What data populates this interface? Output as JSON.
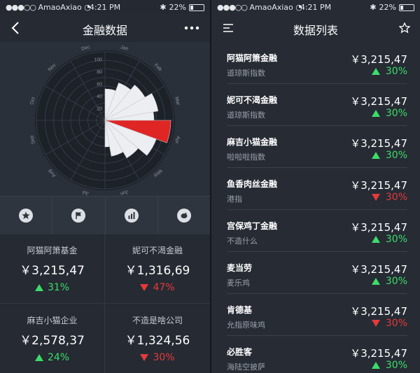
{
  "left": {
    "status": {
      "carrier": "AmaoAxiao",
      "time": "4:21 PM",
      "battery": "22%"
    },
    "title": "金融数据",
    "radial_chart": {
      "months": [
        "Jan",
        "Feb",
        "Mar",
        "Apr",
        "May",
        "Jun",
        "Jul",
        "Aug",
        "Sep",
        "Oct",
        "Nov",
        "Dec"
      ],
      "radial_ticks": [
        "100",
        "80",
        "60",
        "40",
        "20"
      ]
    },
    "cards": [
      {
        "name": "阿猫阿箫基金",
        "price": "￥3,215,47",
        "change": "31%",
        "dir": "up"
      },
      {
        "name": "妮可不渴金融",
        "price": "￥1,316,69",
        "change": "47%",
        "dir": "down"
      },
      {
        "name": "麻吉小猫企业",
        "price": "￥2,578,37",
        "change": "24%",
        "dir": "up"
      },
      {
        "name": "不造是啥公司",
        "price": "￥1,324,56",
        "change": "30%",
        "dir": "down"
      }
    ]
  },
  "right": {
    "status": {
      "carrier": "AmaoAxiao",
      "time": "4:21 PM",
      "battery": "22%"
    },
    "title": "数据列表",
    "rows": [
      {
        "name": "阿猫阿箫金融",
        "sub": "道琼斯指数",
        "price": "￥3,215,47",
        "change": "30%",
        "dir": "up"
      },
      {
        "name": "妮可不渴金融",
        "sub": "道琼斯指数",
        "price": "￥3,215,47",
        "change": "30%",
        "dir": "up"
      },
      {
        "name": "麻吉小猫金融",
        "sub": "啦啦啦指数",
        "price": "￥3,215,47",
        "change": "30%",
        "dir": "up"
      },
      {
        "name": "鱼香肉丝金融",
        "sub": "港指",
        "price": "￥3,215,47",
        "change": "30%",
        "dir": "down"
      },
      {
        "name": "宫保鸡丁金融",
        "sub": "不造什么",
        "price": "￥3,215,47",
        "change": "30%",
        "dir": "up"
      },
      {
        "name": "麦当劳",
        "sub": "麦乐鸡",
        "price": "￥3,215,47",
        "change": "30%",
        "dir": "up"
      },
      {
        "name": "肯德基",
        "sub": "允指原味鸡",
        "price": "￥3,215,47",
        "change": "30%",
        "dir": "down"
      },
      {
        "name": "必胜客",
        "sub": "海陆空披萨",
        "price": "￥3,215,47",
        "change": "30%",
        "dir": "up"
      }
    ]
  },
  "colors": {
    "up": "#3ddc6a",
    "down": "#e53a3a",
    "highlight": "#e02525"
  }
}
